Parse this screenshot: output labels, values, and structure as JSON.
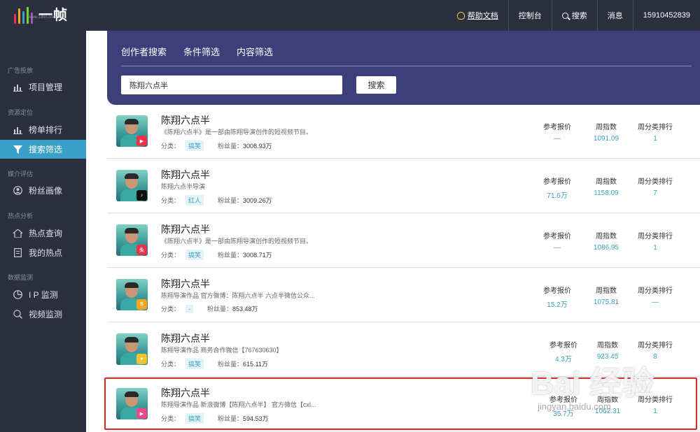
{
  "app": {
    "name": "一帧",
    "sub": "www.1dhn.com"
  },
  "topbar": {
    "help": "帮助文档",
    "console": "控制台",
    "search": "搜索",
    "messages": "消息",
    "user": "15910452839"
  },
  "sidebar": {
    "sections": [
      {
        "title": "广告投放",
        "items": [
          {
            "label": "项目管理",
            "icon": "bar-chart-icon"
          }
        ]
      },
      {
        "title": "资源定位",
        "items": [
          {
            "label": "榜单排行",
            "icon": "bar-chart-icon"
          },
          {
            "label": "搜索筛选",
            "icon": "filter-icon",
            "active": true
          }
        ]
      },
      {
        "title": "媒介评估",
        "items": [
          {
            "label": "粉丝画像",
            "icon": "user-circle-icon"
          }
        ]
      },
      {
        "title": "热点分析",
        "items": [
          {
            "label": "热点查询",
            "icon": "home-icon"
          },
          {
            "label": "我的热点",
            "icon": "document-icon"
          }
        ]
      },
      {
        "title": "数据监测",
        "items": [
          {
            "label": "I P 监测",
            "icon": "pie-icon"
          },
          {
            "label": "视频监测",
            "icon": "search-icon"
          }
        ]
      }
    ]
  },
  "search": {
    "tabs": [
      "创作者搜索",
      "条件筛选",
      "内容筛选"
    ],
    "query": "陈翔六点半",
    "button": "搜索"
  },
  "columns": [
    "参考报价",
    "周指数",
    "周分类排行"
  ],
  "labels": {
    "category": "分类：",
    "fans": "粉丝量："
  },
  "results": [
    {
      "name": "陈翔六点半",
      "desc": "《陈翔六点半》是一部由陈翔导演创作的短视频节目。",
      "category": "搞笑",
      "fans": "3008.93万",
      "price": "—",
      "index": "1091.09",
      "rank": "1",
      "platform": "xigua",
      "badge_color": "#e8344a"
    },
    {
      "name": "陈翔六点半",
      "desc": "陈翔六点半导演",
      "category": "红人",
      "fans": "3009.26万",
      "price": "71.6万",
      "index": "1158.09",
      "rank": "7",
      "platform": "douyin",
      "badge_color": "#111111"
    },
    {
      "name": "陈翔六点半",
      "desc": "《陈翔六点半》是一部由陈翔导演创作的短视频节目。",
      "category": "搞笑",
      "fans": "3008.71万",
      "price": "—",
      "index": "1086.95",
      "rank": "1",
      "platform": "toutiao",
      "badge_color": "#e8344a"
    },
    {
      "name": "陈翔六点半",
      "desc": "陈翔导演作品 官方微博：陈翔六点半 六点半微信公众...",
      "category": "-",
      "fans": "853.48万",
      "price": "15.2万",
      "index": "1075.81",
      "rank": "—",
      "platform": "kuaishou",
      "badge_color": "#f5a623"
    },
    {
      "name": "陈翔六点半",
      "desc": "陈翔导演作品 商务合作微信【767630630】",
      "category": "搞笑",
      "fans": "615.11万",
      "price": "4.3万",
      "index": "923.45",
      "rank": "8",
      "platform": "miaopai",
      "badge_color": "#f2c530"
    },
    {
      "name": "陈翔六点半",
      "desc": "陈翔导演作品 新浪微博【陈翔六点半】 官方微信【cxl...",
      "category": "搞笑",
      "fans": "594.53万",
      "price": "35.7万",
      "index": "1062.31",
      "rank": "1",
      "platform": "weishi",
      "badge_color": "#f0478a"
    }
  ],
  "watermark": {
    "main": "Bai 经验",
    "sub": "jingyan.baidu.com"
  }
}
